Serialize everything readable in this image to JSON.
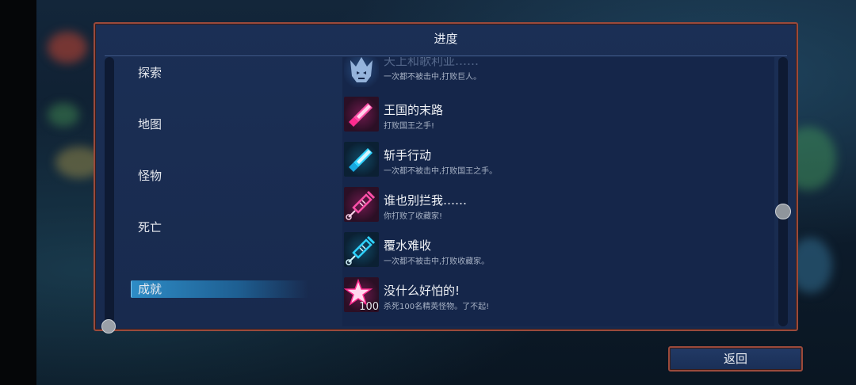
{
  "panel": {
    "title": "进度"
  },
  "categories": [
    {
      "label": "探索"
    },
    {
      "label": "地图"
    },
    {
      "label": "怪物"
    },
    {
      "label": "死亡"
    },
    {
      "label": "成就",
      "active": true
    }
  ],
  "achievements": [
    {
      "title": "天上和歌利亚……",
      "desc": "一次都不被击中,打败巨人。",
      "icon": "giant-mask-icon",
      "faded": true
    },
    {
      "title": "王国的末路",
      "desc": "打败国王之手!",
      "icon": "pink-blade-icon"
    },
    {
      "title": "斩手行动",
      "desc": "一次都不被击中,打败国王之手。",
      "icon": "cyan-blade-icon"
    },
    {
      "title": "谁也别拦我……",
      "desc": "你打败了收藏家!",
      "icon": "pink-syringe-icon"
    },
    {
      "title": "覆水难收",
      "desc": "一次都不被击中,打败收藏家。",
      "icon": "cyan-syringe-icon"
    },
    {
      "title": "没什么好怕的!",
      "desc": "杀死100名精英怪物。了不起!",
      "icon": "star-100-icon",
      "badge": "100"
    }
  ],
  "footer": {
    "back_label": "返回"
  },
  "colors": {
    "panel_border": "#9a4a3c",
    "panel_bg": "#1b2f55",
    "active_tab": "#2e8cc6",
    "pink_accent": "#ff2b8f",
    "cyan_accent": "#2fd2ff"
  }
}
